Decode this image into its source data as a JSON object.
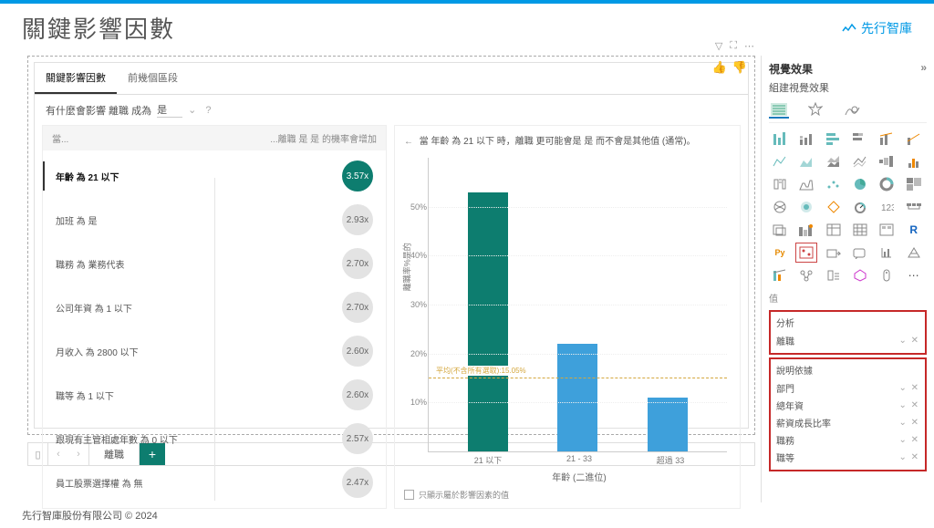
{
  "header": {
    "title": "關鍵影響因數",
    "brand": "先行智庫"
  },
  "visual": {
    "tabs": [
      "關鍵影響因數",
      "前幾個區段"
    ],
    "filter_prefix": "有什麼會影響 離職 成為",
    "filter_value": "是",
    "col_left": "當...",
    "col_right": "...離職 是 是 的機率會增加",
    "influencers": [
      {
        "label": "年齡 為 21 以下",
        "value": "3.57x",
        "top": true
      },
      {
        "label": "加班 為 是",
        "value": "2.93x"
      },
      {
        "label": "職務 為 業務代表",
        "value": "2.70x"
      },
      {
        "label": "公司年資 為 1 以下",
        "value": "2.70x"
      },
      {
        "label": "月收入 為 2800 以下",
        "value": "2.60x"
      },
      {
        "label": "職等 為 1 以下",
        "value": "2.60x"
      },
      {
        "label": "跟現有主管相處年數 為 0 以下",
        "value": "2.57x"
      },
      {
        "label": "員工股票選擇權 為 無",
        "value": "2.47x"
      }
    ],
    "chart": {
      "title": "當 年齡 為 21 以下 時，離職 更可能會是 是 而不會是其他值 (通常)。",
      "xlabel": "年齡 (二進位)",
      "ylabel": "離職率%是的",
      "avg_label": "平均(不含所有選取):15.05%",
      "checkbox": "只顯示屬於影響因素的值"
    }
  },
  "chart_data": {
    "type": "bar",
    "categories": [
      "21 以下",
      "21 - 33",
      "超過 33"
    ],
    "values": [
      53,
      22,
      11
    ],
    "avg": 15.05,
    "ylim": [
      0,
      60
    ],
    "yticks": [
      10,
      20,
      30,
      40,
      50
    ]
  },
  "sheets": {
    "active": "離職"
  },
  "right_pane": {
    "title": "視覺效果",
    "subtitle": "組建視覺效果",
    "values_label": "值",
    "analysis": {
      "title": "分析",
      "field": "離職"
    },
    "explain": {
      "title": "說明依據",
      "fields": [
        "部門",
        "總年資",
        "薪資成長比率",
        "職務",
        "職等"
      ]
    }
  },
  "footer": "先行智庫股份有限公司 © 2024"
}
